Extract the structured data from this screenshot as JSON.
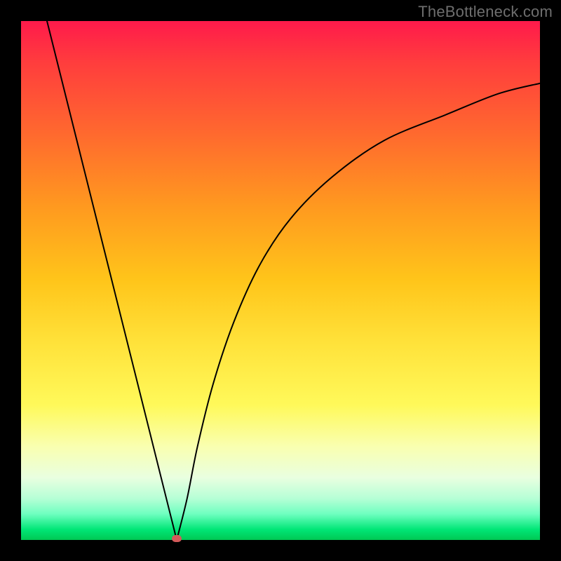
{
  "watermark": "TheBottleneck.com",
  "chart_data": {
    "type": "line",
    "title": "",
    "xlabel": "",
    "ylabel": "",
    "xlim": [
      0,
      100
    ],
    "ylim": [
      0,
      100
    ],
    "grid": false,
    "legend": false,
    "minimum_marker": {
      "x": 30,
      "y": 0
    },
    "series": [
      {
        "name": "left-branch",
        "x": [
          5,
          8,
          12,
          16,
          20,
          24,
          27,
          29,
          30
        ],
        "y": [
          100,
          88,
          72,
          56,
          40,
          24,
          12,
          4,
          0
        ]
      },
      {
        "name": "right-branch",
        "x": [
          30,
          32,
          34,
          37,
          41,
          46,
          52,
          60,
          70,
          82,
          92,
          100
        ],
        "y": [
          0,
          8,
          18,
          30,
          42,
          53,
          62,
          70,
          77,
          82,
          86,
          88
        ]
      }
    ]
  },
  "colors": {
    "background": "#000000",
    "curve": "#000000",
    "marker": "#d45a5a",
    "gradient_top": "#ff1a4b",
    "gradient_mid": "#ffe23a",
    "gradient_bottom": "#00c853",
    "watermark": "#6e6e6e"
  }
}
